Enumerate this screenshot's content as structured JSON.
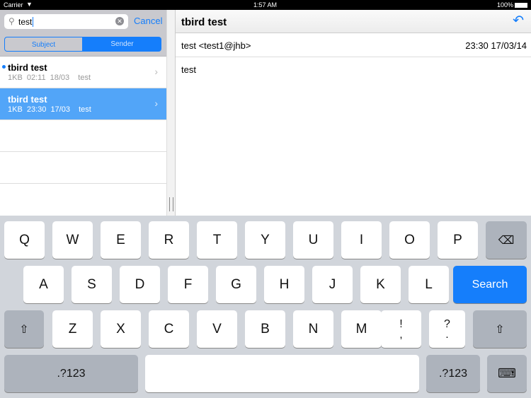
{
  "status": {
    "carrier": "Carrier",
    "time": "1:57 AM",
    "battery": "100%"
  },
  "search": {
    "value": "test",
    "cancel": "Cancel"
  },
  "segments": [
    "Subject",
    "Sender"
  ],
  "selected_segment": "Sender",
  "messages": [
    {
      "title": "tbird test",
      "size": "1KB",
      "time": "02:11 18/03",
      "sender": "test",
      "unread": true,
      "selected": false
    },
    {
      "title": "tbird test",
      "size": "1KB",
      "time": "23:30 17/03",
      "sender": "test",
      "unread": false,
      "selected": true
    }
  ],
  "detail": {
    "title": "tbird test",
    "from": "test <test1@jhb>",
    "date": "23:30 17/03/14",
    "body": "test"
  },
  "keyboard": {
    "row1": [
      "Q",
      "W",
      "E",
      "R",
      "T",
      "Y",
      "U",
      "I",
      "O",
      "P"
    ],
    "row2": [
      "A",
      "S",
      "D",
      "F",
      "G",
      "H",
      "J",
      "K",
      "L"
    ],
    "row3": [
      "Z",
      "X",
      "C",
      "V",
      "B",
      "N",
      "M"
    ],
    "punct1": {
      "top": "!",
      "bottom": ","
    },
    "punct2": {
      "top": "?",
      "bottom": "."
    },
    "search": "Search",
    "numbers": ".?123"
  },
  "colors": {
    "accent": "#157efb",
    "selected_row": "#52a5f8"
  }
}
